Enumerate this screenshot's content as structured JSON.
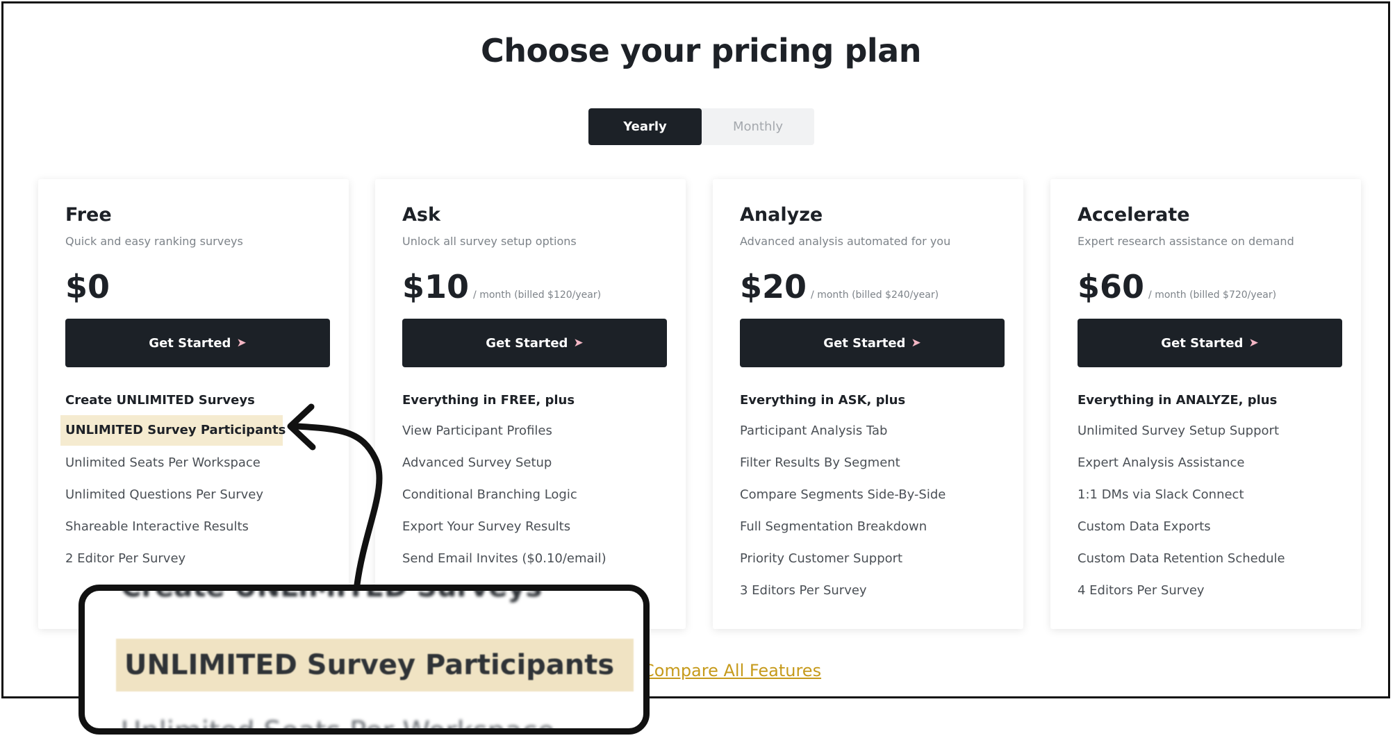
{
  "page": {
    "title": "Choose your pricing plan",
    "billing_toggle": {
      "options": [
        "Yearly",
        "Monthly"
      ],
      "selected": "Yearly"
    },
    "compare_link": "Compare All Features"
  },
  "plans": [
    {
      "name": "Free",
      "description": "Quick and easy ranking surveys",
      "price": "$0",
      "period": "",
      "cta": "Get Started",
      "lead": "Create UNLIMITED Surveys",
      "features": [
        "UNLIMITED Survey Participants",
        "Unlimited Seats Per Workspace",
        "Unlimited Questions Per Survey",
        "Shareable Interactive Results",
        "2 Editor Per Survey"
      ]
    },
    {
      "name": "Ask",
      "description": "Unlock all survey setup options",
      "price": "$10",
      "period": "/ month (billed $120/year)",
      "cta": "Get Started",
      "lead": "Everything in FREE, plus",
      "features": [
        "View Participant Profiles",
        "Advanced Survey Setup",
        "Conditional Branching Logic",
        "Export Your Survey Results",
        "Send Email Invites ($0.10/email)"
      ]
    },
    {
      "name": "Analyze",
      "description": "Advanced analysis automated for you",
      "price": "$20",
      "period": "/ month (billed $240/year)",
      "cta": "Get Started",
      "lead": "Everything in ASK, plus",
      "features": [
        "Participant Analysis Tab",
        "Filter Results By Segment",
        "Compare Segments Side-By-Side",
        "Full Segmentation Breakdown",
        "Priority Customer Support",
        "3 Editors Per Survey"
      ]
    },
    {
      "name": "Accelerate",
      "description": "Expert research assistance on demand",
      "price": "$60",
      "period": "/ month (billed $720/year)",
      "cta": "Get Started",
      "lead": "Everything in ANALYZE, plus",
      "features": [
        "Unlimited Survey Setup Support",
        "Expert Analysis Assistance",
        "1:1 DMs via Slack Connect",
        "Custom Data Exports",
        "Custom Data Retention Schedule",
        "4 Editors Per Survey"
      ]
    }
  ],
  "callout": {
    "above": "Create UNLIMITED Surveys",
    "highlight": "UNLIMITED Survey Participants",
    "below": "Unlimited Seats Per Workspace"
  },
  "colors": {
    "dark": "#1c2127",
    "highlight": "#f5ebd0",
    "link": "#c69a1b"
  },
  "icons": {
    "cta": "rocket-icon"
  }
}
